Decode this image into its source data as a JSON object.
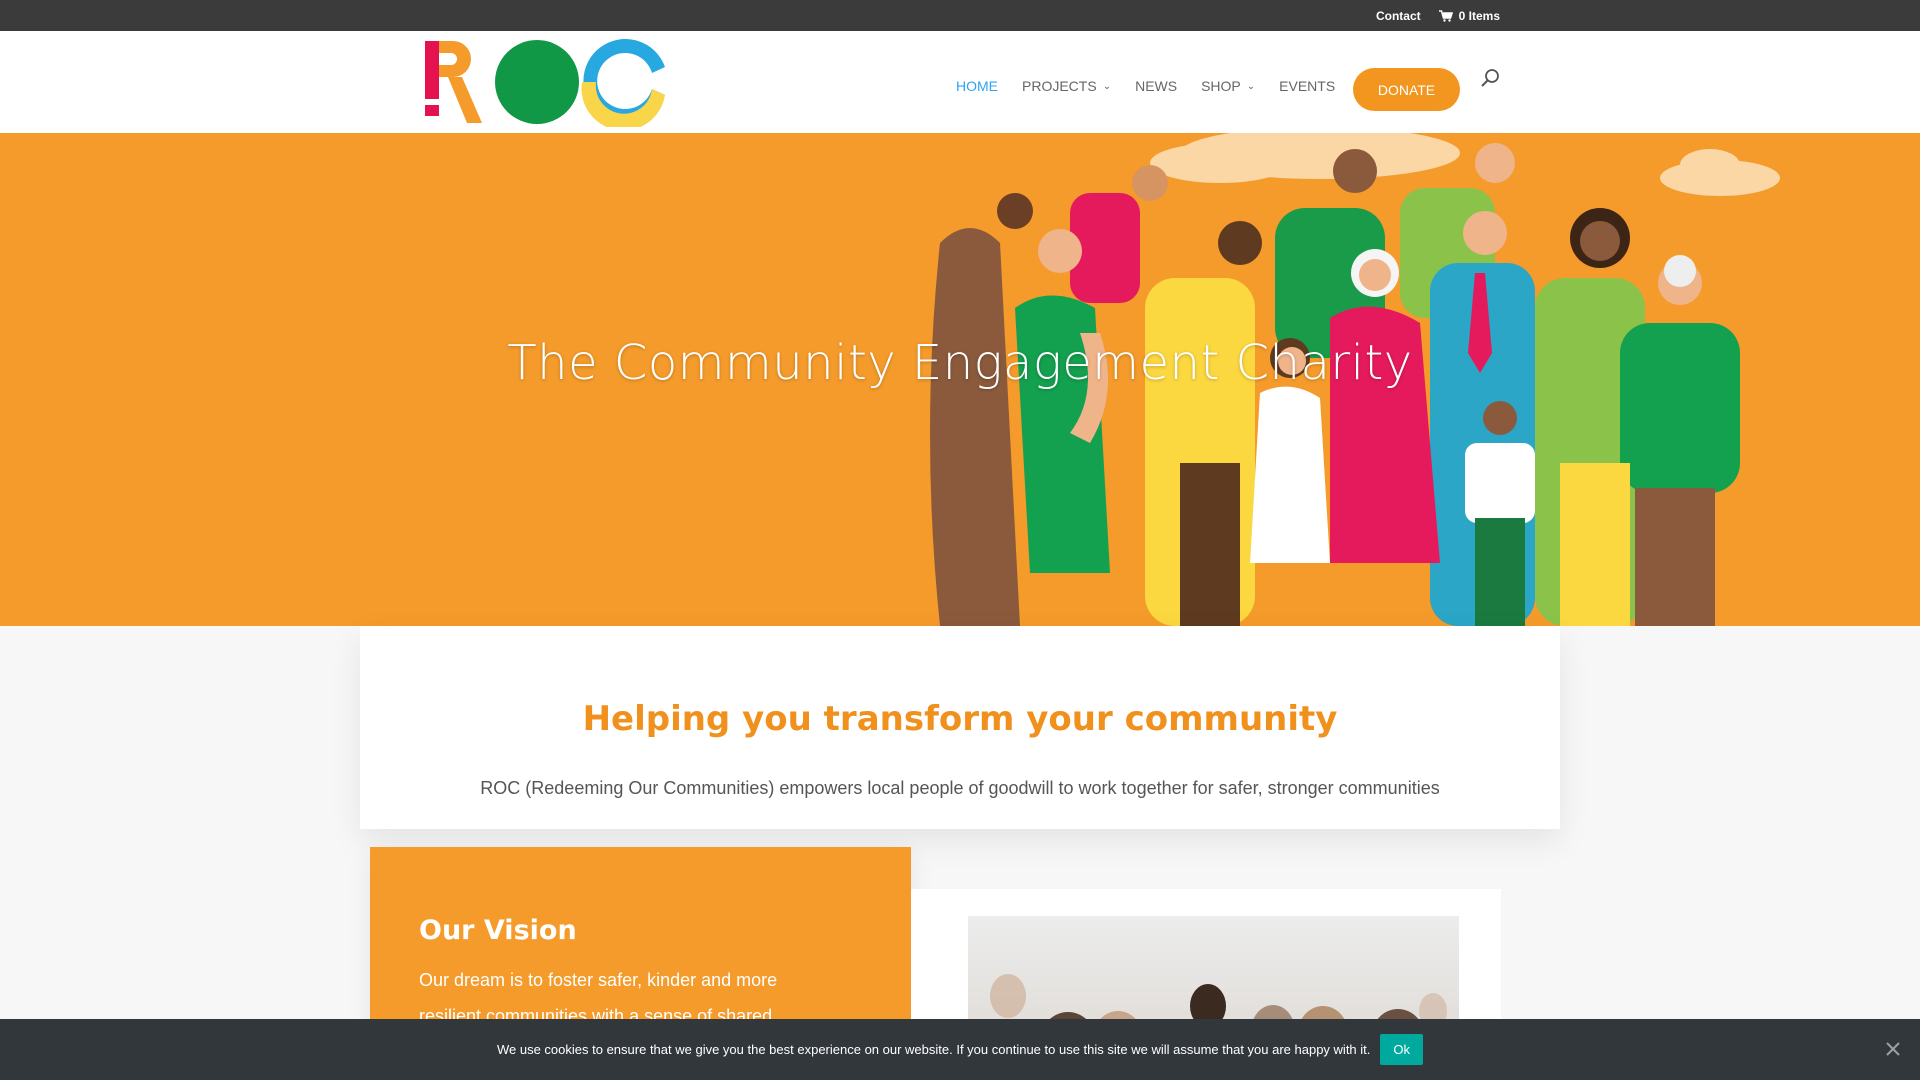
{
  "topbar": {
    "contact": "Contact",
    "cart": "0 Items"
  },
  "brand": {
    "logo_text": "ROC",
    "colors": {
      "r": "#e4134f",
      "dot": "#e4134f",
      "o": "#109846",
      "c_top": "#27a8e0",
      "c_bottom": "#f9d54a"
    }
  },
  "nav": {
    "home": "HOME",
    "projects": "PROJECTS",
    "news": "NEWS",
    "shop": "SHOP",
    "events": "EVENTS",
    "donate": "DONATE"
  },
  "hero": {
    "title": "The Community Engagement Charity"
  },
  "intro": {
    "heading": "Helping you transform your community",
    "body": "ROC (Redeeming Our Communities) empowers local people of goodwill to work together for safer, stronger communities"
  },
  "vision": {
    "heading": "Our Vision",
    "body": "Our dream is to foster safer, kinder and more resilient communities with a sense of shared"
  },
  "cookie": {
    "message": "We use cookies to ensure that we give you the best experience on our website. If you continue to use this site we will assume that you are happy with it.",
    "ok": "Ok"
  },
  "colors": {
    "accent": "#f49b2b",
    "link_active": "#2ea3f2",
    "topbar": "#3b3b3b",
    "cookie_bg": "#32373c",
    "cookie_ok": "#00a99d"
  },
  "icons": [
    "cart-icon",
    "search-icon",
    "chevron-down-icon",
    "close-icon"
  ]
}
